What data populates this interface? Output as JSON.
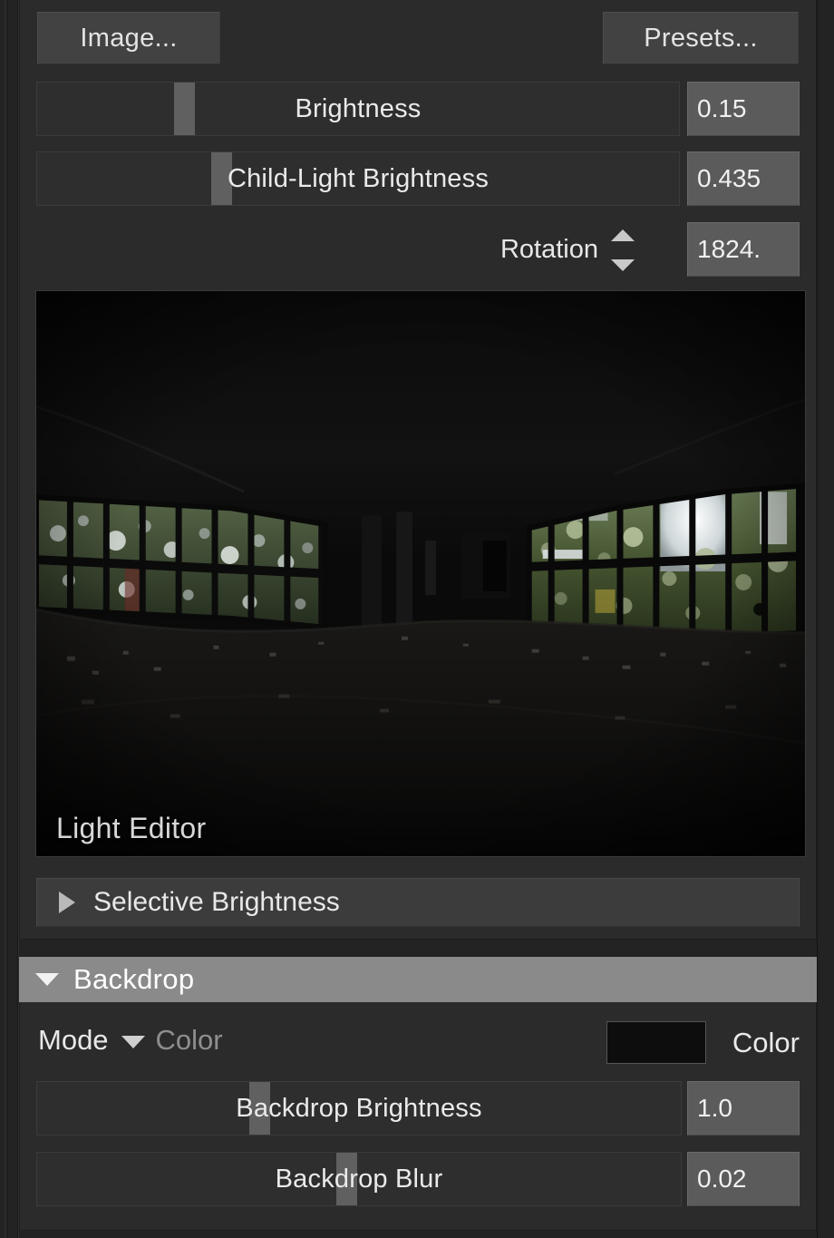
{
  "panel": {
    "buttons": {
      "image": "Image...",
      "presets": "Presets..."
    },
    "sliders": [
      {
        "label": "Brightness",
        "value": "0.15",
        "handle_pct": 22
      },
      {
        "label": "Child-Light Brightness",
        "value": "0.435",
        "handle_pct": 28
      }
    ],
    "rotation": {
      "label": "Rotation",
      "value": "1824.",
      "spinner_up_icon": "triangle-up-icon",
      "spinner_down_icon": "triangle-down-icon"
    },
    "preview": {
      "caption": "Light Editor"
    },
    "selective": {
      "label": "Selective Brightness",
      "expand_icon": "triangle-right-icon",
      "expanded": false
    }
  },
  "backdrop": {
    "title": "Backdrop",
    "collapse_icon": "triangle-down-icon",
    "expanded": true,
    "mode": {
      "label": "Mode",
      "caret_icon": "chevron-down-icon",
      "value": "Color"
    },
    "color": {
      "label": "Color",
      "swatch_hex": "#0d0d0d"
    },
    "sliders": [
      {
        "label": "Backdrop Brightness",
        "value": "1.0",
        "handle_pct": 34
      },
      {
        "label": "Backdrop Blur",
        "value": "0.02",
        "handle_pct": 48
      }
    ]
  },
  "theme": {
    "panel_bg": "#2b2b2b",
    "window_bg": "#232323",
    "button_bg": "#424242",
    "value_bg": "#5b5b5b",
    "slider_handle": "#606060",
    "header_bg": "#8a8a8a",
    "text": "#e8e8e8",
    "text_dim": "#8e8e8e"
  }
}
